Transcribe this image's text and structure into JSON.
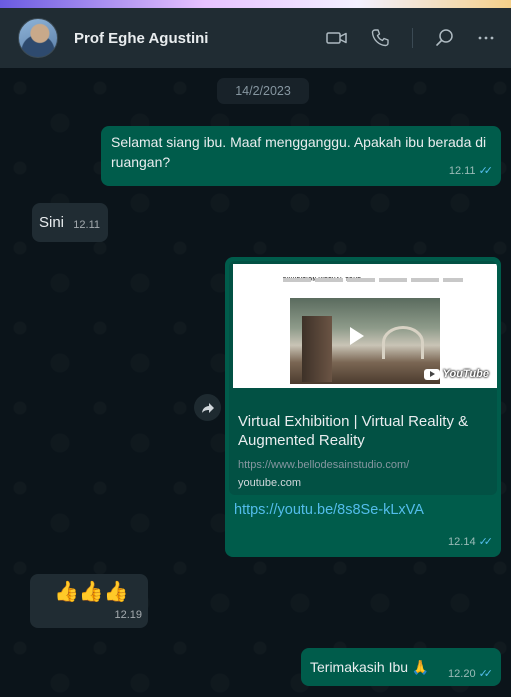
{
  "header": {
    "contact_name": "Prof Eghe Agustini",
    "icons": [
      "video-call-icon",
      "voice-call-icon",
      "search-icon",
      "menu-icon"
    ]
  },
  "chat": {
    "date_label": "14/2/2023",
    "messages": [
      {
        "direction": "outgoing",
        "text": "Selamat siang ibu. Maaf mengganggu. Apakah ibu berada di ruangan?",
        "time": "12.11",
        "status": "read"
      },
      {
        "direction": "incoming",
        "text": "Sini",
        "time": "12.11"
      },
      {
        "direction": "outgoing",
        "type": "link",
        "preview": {
          "thumb_title": "EXHIBITION VIRTUAL TOUR",
          "thumb_brand": "YouTube",
          "title": "Virtual Exhibition | Virtual Reality & Augmented Reality",
          "url": "https://www.bellodesainstudio.com/",
          "domain": "youtube.com"
        },
        "link": "https://youtu.be/8s8Se-kLxVA",
        "time": "12.14",
        "status": "read"
      },
      {
        "direction": "incoming",
        "text": "👍👍👍",
        "time": "12.19"
      },
      {
        "direction": "outgoing",
        "text": "Terimakasih Ibu 🙏",
        "time": "12.20",
        "status": "read"
      }
    ]
  },
  "colors": {
    "header_bg": "#202c33",
    "chat_bg": "#0b141a",
    "outgoing_bubble": "#005c4b",
    "incoming_bubble": "#202c33",
    "read_ticks": "#53bdeb",
    "link": "#53bdeb"
  }
}
